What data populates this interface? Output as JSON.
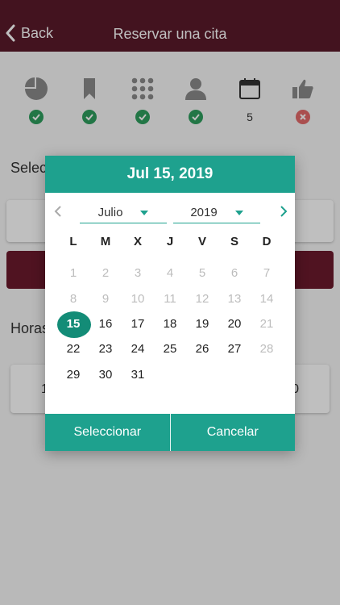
{
  "navbar": {
    "back_label": "Back",
    "title": "Reservar una cita"
  },
  "steps": [
    {
      "icon": "pie-chart-icon",
      "status": "done"
    },
    {
      "icon": "bookmark-icon",
      "status": "done"
    },
    {
      "icon": "grid-icon",
      "status": "done"
    },
    {
      "icon": "user-icon",
      "status": "done"
    },
    {
      "icon": "calendar-icon",
      "status": "current",
      "label": "5"
    },
    {
      "icon": "thumbs-up-icon",
      "status": "error"
    }
  ],
  "background": {
    "select_label": "Selec",
    "hours_label": "Horas",
    "hour_slot_left": "1",
    "hour_slot_right": "0"
  },
  "datepicker": {
    "header": "Jul 15, 2019",
    "month": "Julio",
    "year": "2019",
    "weekdays": [
      "L",
      "M",
      "X",
      "J",
      "V",
      "S",
      "D"
    ],
    "weeks": [
      [
        "1",
        "2",
        "3",
        "4",
        "5",
        "6",
        "7"
      ],
      [
        "8",
        "9",
        "10",
        "11",
        "12",
        "13",
        "14"
      ],
      [
        "15",
        "16",
        "17",
        "18",
        "19",
        "20",
        "21"
      ],
      [
        "22",
        "23",
        "24",
        "25",
        "26",
        "27",
        "28"
      ],
      [
        "29",
        "30",
        "31",
        "",
        "",
        "",
        ""
      ]
    ],
    "disabled": [
      "1",
      "2",
      "3",
      "4",
      "5",
      "6",
      "7",
      "8",
      "9",
      "10",
      "11",
      "12",
      "13",
      "14",
      "21",
      "28"
    ],
    "selected": "15",
    "select_label": "Seleccionar",
    "cancel_label": "Cancelar"
  },
  "colors": {
    "primary": "#5a1a2a",
    "accent": "#1ea18e",
    "success": "#2e9e5e",
    "error": "#e36a6a"
  }
}
